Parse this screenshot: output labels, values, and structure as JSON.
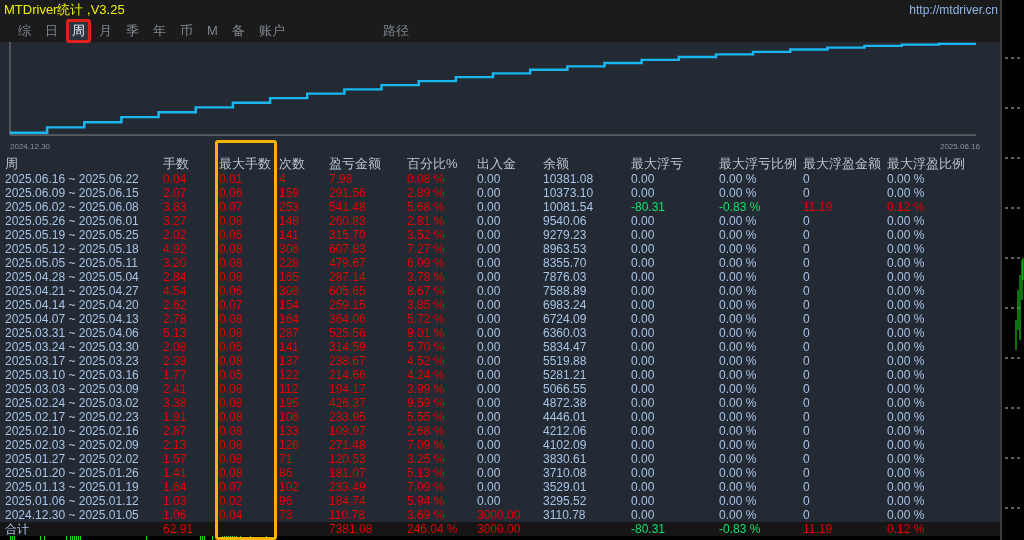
{
  "window": {
    "title": "MTDriver统计 ,V3.25",
    "link": "http://mtdriver.cn"
  },
  "tabs": [
    {
      "label": "综",
      "selected": false,
      "highlighted": false
    },
    {
      "label": "日",
      "selected": false,
      "highlighted": false
    },
    {
      "label": "周",
      "selected": true,
      "highlighted": true
    },
    {
      "label": "月",
      "selected": false,
      "highlighted": false
    },
    {
      "label": "季",
      "selected": false,
      "highlighted": false
    },
    {
      "label": "年",
      "selected": false,
      "highlighted": false
    },
    {
      "label": "币",
      "selected": false,
      "highlighted": false
    },
    {
      "label": "M",
      "selected": false,
      "highlighted": false
    },
    {
      "label": "备",
      "selected": false,
      "highlighted": false
    },
    {
      "label": "账户",
      "selected": false,
      "highlighted": false
    },
    {
      "label": "路径",
      "selected": false,
      "highlighted": false
    }
  ],
  "equity_chart": {
    "start_label": "2024.12.30",
    "end_label": "2025.06.16"
  },
  "table": {
    "columns": [
      {
        "label": "周",
        "kind": "label",
        "highlighted": false
      },
      {
        "label": "手数",
        "kind": "metric",
        "highlighted": false
      },
      {
        "label": "最大手数",
        "kind": "metric",
        "highlighted": true
      },
      {
        "label": "次数",
        "kind": "metric",
        "highlighted": false
      },
      {
        "label": "盈亏金额",
        "kind": "metric",
        "highlighted": false
      },
      {
        "label": "百分比%",
        "kind": "metric",
        "highlighted": false
      },
      {
        "label": "出入金",
        "kind": "deposit",
        "highlighted": false
      },
      {
        "label": "余额",
        "kind": "balance",
        "highlighted": false
      },
      {
        "label": "最大浮亏",
        "kind": "float_loss",
        "highlighted": false
      },
      {
        "label": "最大浮亏比例",
        "kind": "float_loss",
        "highlighted": false
      },
      {
        "label": "最大浮盈金额",
        "kind": "float_profit",
        "highlighted": false
      },
      {
        "label": "最大浮盈比例",
        "kind": "float_profit",
        "highlighted": false
      }
    ],
    "rows": [
      {
        "deposit_made": false,
        "float_hit": false,
        "cells": [
          "2025.06.16 ~ 2025.06.22",
          "0.04",
          "0.01",
          "4",
          "7.98",
          "0.08 %",
          "0.00",
          "10381.08",
          "0.00",
          "0.00 %",
          "0",
          "0.00 %"
        ]
      },
      {
        "deposit_made": false,
        "float_hit": false,
        "cells": [
          "2025.06.09 ~ 2025.06.15",
          "2.07",
          "0.06",
          "159",
          "291.56",
          "2.89 %",
          "0.00",
          "10373.10",
          "0.00",
          "0.00 %",
          "0",
          "0.00 %"
        ]
      },
      {
        "deposit_made": false,
        "float_hit": true,
        "cells": [
          "2025.06.02 ~ 2025.06.08",
          "3.83",
          "0.07",
          "253",
          "541.48",
          "5.68 %",
          "0.00",
          "10081.54",
          "-80.31",
          "-0.83 %",
          "11.19",
          "0.12 %"
        ]
      },
      {
        "deposit_made": false,
        "float_hit": false,
        "cells": [
          "2025.05.26 ~ 2025.06.01",
          "3.27",
          "0.08",
          "148",
          "260.83",
          "2.81 %",
          "0.00",
          "9540.06",
          "0.00",
          "0.00 %",
          "0",
          "0.00 %"
        ]
      },
      {
        "deposit_made": false,
        "float_hit": false,
        "cells": [
          "2025.05.19 ~ 2025.05.25",
          "2.02",
          "0.05",
          "141",
          "315.70",
          "3.52 %",
          "0.00",
          "9279.23",
          "0.00",
          "0.00 %",
          "0",
          "0.00 %"
        ]
      },
      {
        "deposit_made": false,
        "float_hit": false,
        "cells": [
          "2025.05.12 ~ 2025.05.18",
          "4.92",
          "0.08",
          "306",
          "607.83",
          "7.27 %",
          "0.00",
          "8963.53",
          "0.00",
          "0.00 %",
          "0",
          "0.00 %"
        ]
      },
      {
        "deposit_made": false,
        "float_hit": false,
        "cells": [
          "2025.05.05 ~ 2025.05.11",
          "3.20",
          "0.08",
          "228",
          "479.67",
          "6.09 %",
          "0.00",
          "8355.70",
          "0.00",
          "0.00 %",
          "0",
          "0.00 %"
        ]
      },
      {
        "deposit_made": false,
        "float_hit": false,
        "cells": [
          "2025.04.28 ~ 2025.05.04",
          "2.84",
          "0.08",
          "165",
          "287.14",
          "3.78 %",
          "0.00",
          "7876.03",
          "0.00",
          "0.00 %",
          "0",
          "0.00 %"
        ]
      },
      {
        "deposit_made": false,
        "float_hit": false,
        "cells": [
          "2025.04.21 ~ 2025.04.27",
          "4.54",
          "0.06",
          "308",
          "605.65",
          "8.67 %",
          "0.00",
          "7588.89",
          "0.00",
          "0.00 %",
          "0",
          "0.00 %"
        ]
      },
      {
        "deposit_made": false,
        "float_hit": false,
        "cells": [
          "2025.04.14 ~ 2025.04.20",
          "2.62",
          "0.07",
          "154",
          "259.15",
          "3.85 %",
          "0.00",
          "6983.24",
          "0.00",
          "0.00 %",
          "0",
          "0.00 %"
        ]
      },
      {
        "deposit_made": false,
        "float_hit": false,
        "cells": [
          "2025.04.07 ~ 2025.04.13",
          "2.78",
          "0.08",
          "164",
          "364.06",
          "5.72 %",
          "0.00",
          "6724.09",
          "0.00",
          "0.00 %",
          "0",
          "0.00 %"
        ]
      },
      {
        "deposit_made": false,
        "float_hit": false,
        "cells": [
          "2025.03.31 ~ 2025.04.06",
          "5.13",
          "0.08",
          "287",
          "525.56",
          "9.01 %",
          "0.00",
          "6360.03",
          "0.00",
          "0.00 %",
          "0",
          "0.00 %"
        ]
      },
      {
        "deposit_made": false,
        "float_hit": false,
        "cells": [
          "2025.03.24 ~ 2025.03.30",
          "2.08",
          "0.05",
          "141",
          "314.59",
          "5.70 %",
          "0.00",
          "5834.47",
          "0.00",
          "0.00 %",
          "0",
          "0.00 %"
        ]
      },
      {
        "deposit_made": false,
        "float_hit": false,
        "cells": [
          "2025.03.17 ~ 2025.03.23",
          "2.39",
          "0.08",
          "137",
          "238.67",
          "4.52 %",
          "0.00",
          "5519.88",
          "0.00",
          "0.00 %",
          "0",
          "0.00 %"
        ]
      },
      {
        "deposit_made": false,
        "float_hit": false,
        "cells": [
          "2025.03.10 ~ 2025.03.16",
          "1.77",
          "0.05",
          "122",
          "214.66",
          "4.24 %",
          "0.00",
          "5281.21",
          "0.00",
          "0.00 %",
          "0",
          "0.00 %"
        ]
      },
      {
        "deposit_made": false,
        "float_hit": false,
        "cells": [
          "2025.03.03 ~ 2025.03.09",
          "2.41",
          "0.08",
          "112",
          "194.17",
          "3.99 %",
          "0.00",
          "5066.55",
          "0.00",
          "0.00 %",
          "0",
          "0.00 %"
        ]
      },
      {
        "deposit_made": false,
        "float_hit": false,
        "cells": [
          "2025.02.24 ~ 2025.03.02",
          "3.38",
          "0.08",
          "195",
          "426.37",
          "9.59 %",
          "0.00",
          "4872.38",
          "0.00",
          "0.00 %",
          "0",
          "0.00 %"
        ]
      },
      {
        "deposit_made": false,
        "float_hit": false,
        "cells": [
          "2025.02.17 ~ 2025.02.23",
          "1.91",
          "0.08",
          "106",
          "233.95",
          "5.55 %",
          "0.00",
          "4446.01",
          "0.00",
          "0.00 %",
          "0",
          "0.00 %"
        ]
      },
      {
        "deposit_made": false,
        "float_hit": false,
        "cells": [
          "2025.02.10 ~ 2025.02.16",
          "2.87",
          "0.08",
          "133",
          "109.97",
          "2.68 %",
          "0.00",
          "4212.06",
          "0.00",
          "0.00 %",
          "0",
          "0.00 %"
        ]
      },
      {
        "deposit_made": false,
        "float_hit": false,
        "cells": [
          "2025.02.03 ~ 2025.02.09",
          "2.13",
          "0.08",
          "126",
          "271.48",
          "7.09 %",
          "0.00",
          "4102.09",
          "0.00",
          "0.00 %",
          "0",
          "0.00 %"
        ]
      },
      {
        "deposit_made": false,
        "float_hit": false,
        "cells": [
          "2025.01.27 ~ 2025.02.02",
          "1.57",
          "0.08",
          "71",
          "120.53",
          "3.25 %",
          "0.00",
          "3830.61",
          "0.00",
          "0.00 %",
          "0",
          "0.00 %"
        ]
      },
      {
        "deposit_made": false,
        "float_hit": false,
        "cells": [
          "2025.01.20 ~ 2025.01.26",
          "1.41",
          "0.08",
          "86",
          "181.07",
          "5.13 %",
          "0.00",
          "3710.08",
          "0.00",
          "0.00 %",
          "0",
          "0.00 %"
        ]
      },
      {
        "deposit_made": false,
        "float_hit": false,
        "cells": [
          "2025.01.13 ~ 2025.01.19",
          "1.64",
          "0.07",
          "102",
          "233.49",
          "7.09 %",
          "0.00",
          "3529.01",
          "0.00",
          "0.00 %",
          "0",
          "0.00 %"
        ]
      },
      {
        "deposit_made": false,
        "float_hit": false,
        "cells": [
          "2025.01.06 ~ 2025.01.12",
          "1.03",
          "0.02",
          "96",
          "184.74",
          "5.94 %",
          "0.00",
          "3295.52",
          "0.00",
          "0.00 %",
          "0",
          "0.00 %"
        ]
      },
      {
        "deposit_made": true,
        "float_hit": false,
        "cells": [
          "2024.12.30 ~ 2025.01.05",
          "1.06",
          "0.04",
          "73",
          "110.78",
          "3.69 %",
          "3000.00",
          "3110.78",
          "0.00",
          "0.00 %",
          "0",
          "0.00 %"
        ]
      }
    ],
    "total": {
      "deposit_made": true,
      "float_hit": true,
      "cells": [
        "合计",
        "62.91",
        null,
        null,
        "7381.08",
        "246.04 %",
        "3000.00",
        null,
        "-80.31",
        "-0.83 %",
        "11.19",
        "0.12 %"
      ]
    }
  }
}
